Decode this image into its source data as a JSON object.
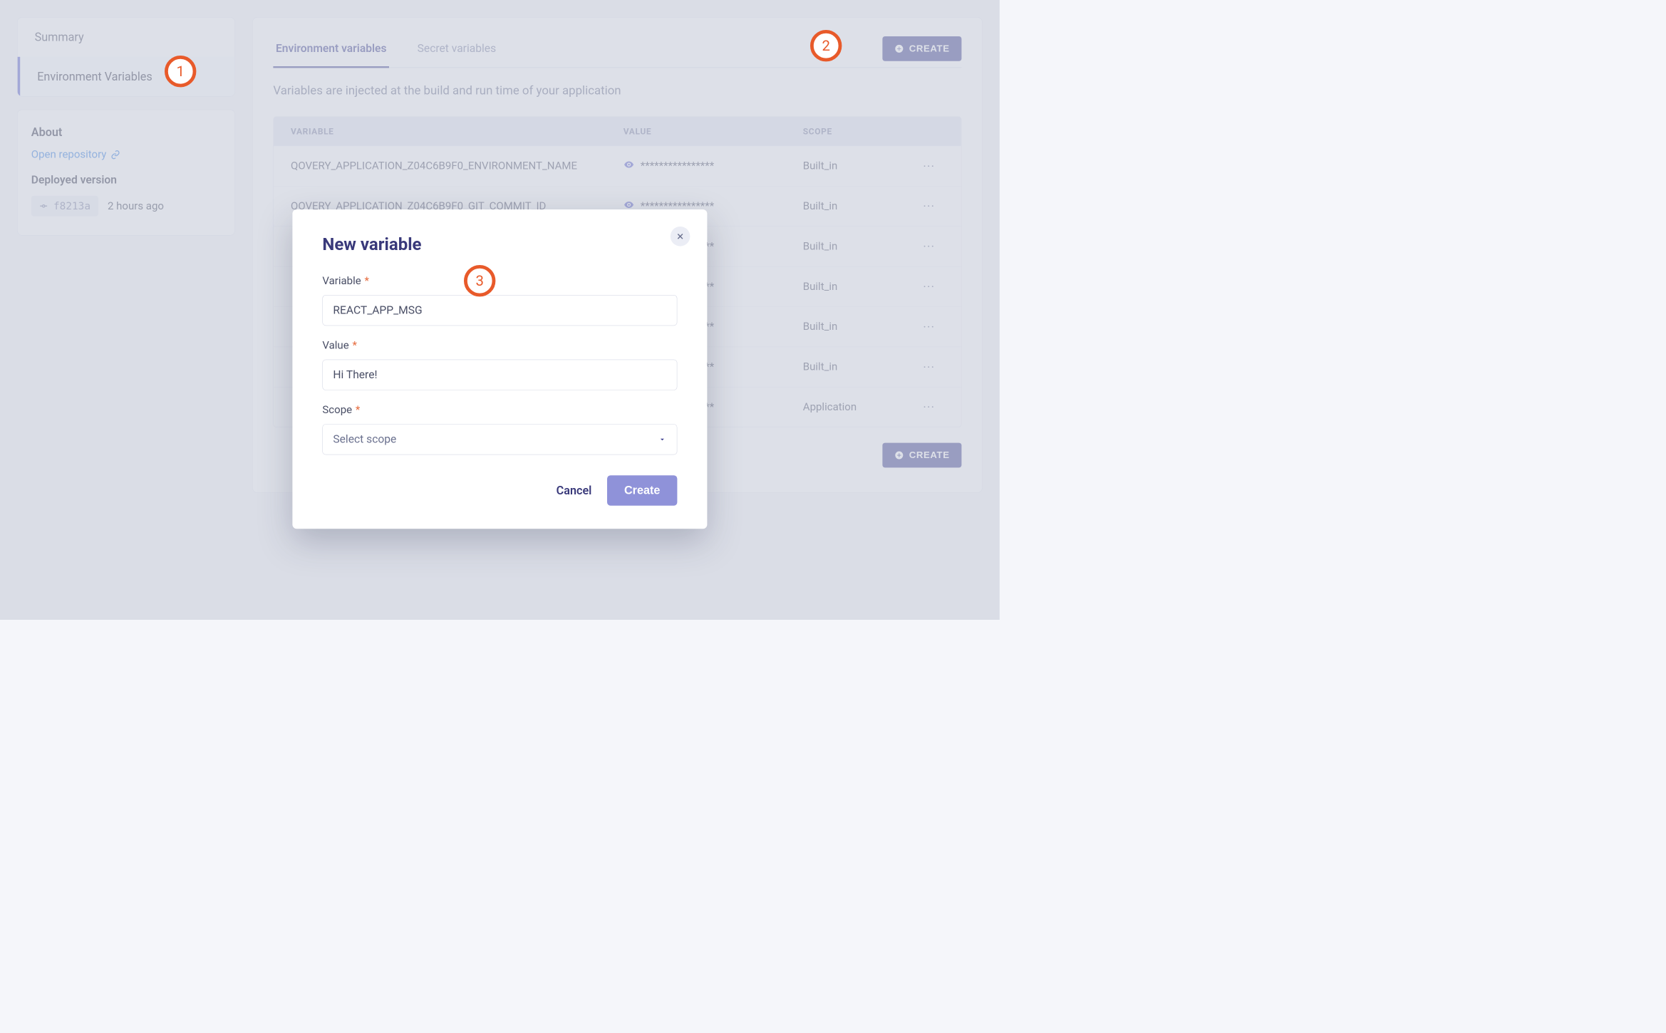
{
  "sidebar": {
    "items": [
      {
        "label": "Summary"
      },
      {
        "label": "Environment Variables"
      }
    ],
    "about_title": "About",
    "open_repo_label": "Open repository",
    "deployed_title": "Deployed version",
    "commit_sha": "f8213a",
    "deployed_ago": "2 hours ago"
  },
  "main": {
    "tabs": [
      {
        "label": "Environment variables"
      },
      {
        "label": "Secret variables"
      }
    ],
    "create_label": "CREATE",
    "description": "Variables are injected at the build and run time of your application",
    "columns": {
      "variable": "VARIABLE",
      "value": "VALUE",
      "scope": "SCOPE"
    },
    "masked_value": "****************",
    "rows": [
      {
        "name": "QOVERY_APPLICATION_Z04C6B9F0_ENVIRONMENT_NAME",
        "scope": "Built_in"
      },
      {
        "name": "QOVERY_APPLICATION_Z04C6B9F0_GIT_COMMIT_ID",
        "scope": "Built_in"
      },
      {
        "name": "",
        "scope": "Built_in"
      },
      {
        "name": "",
        "scope": "Built_in"
      },
      {
        "name": "",
        "scope": "Built_in"
      },
      {
        "name": "",
        "scope": "Built_in"
      },
      {
        "name": "",
        "scope": "Application"
      }
    ]
  },
  "modal": {
    "title": "New variable",
    "variable_label": "Variable",
    "variable_value": "REACT_APP_MSG",
    "value_label": "Value",
    "value_value": "Hi There!",
    "scope_label": "Scope",
    "scope_placeholder": "Select scope",
    "cancel_label": "Cancel",
    "create_label": "Create"
  },
  "callouts": {
    "one": "1",
    "two": "2",
    "three": "3"
  }
}
